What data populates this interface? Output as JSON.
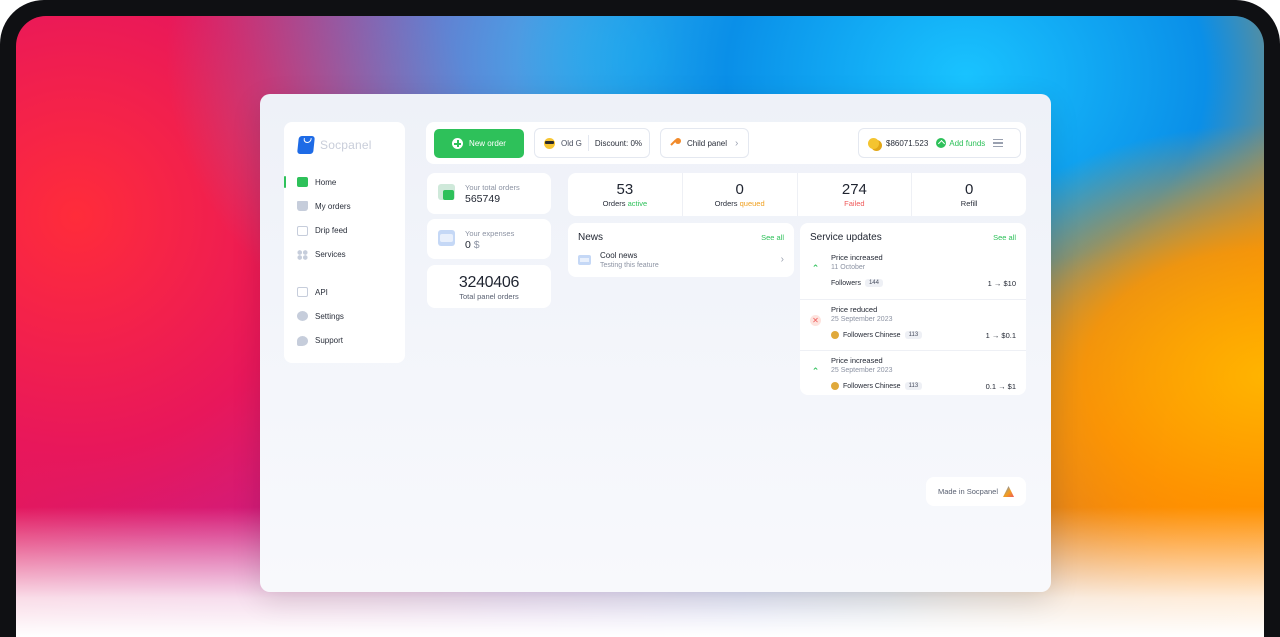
{
  "brand": {
    "name": "Socpanel"
  },
  "sidebar": {
    "items": [
      {
        "label": "Home",
        "icon": "home-icon",
        "active": true
      },
      {
        "label": "My orders",
        "icon": "cart-icon"
      },
      {
        "label": "Drip feed",
        "icon": "calendar-icon"
      },
      {
        "label": "Services",
        "icon": "grid-icon"
      },
      {
        "label": "API",
        "icon": "api-icon"
      },
      {
        "label": "Settings",
        "icon": "gear-icon"
      },
      {
        "label": "Support",
        "icon": "chat-icon"
      }
    ]
  },
  "topbar": {
    "new_order_label": "New order",
    "user_name": "Old G",
    "discount_label": "Discount: 0%",
    "child_panel_label": "Child panel",
    "balance": "$86071.523",
    "add_funds_label": "Add funds"
  },
  "stats": {
    "total_orders_label": "Your total orders",
    "total_orders_value": "565749",
    "expenses_label": "Your expenses",
    "expenses_value": "0",
    "expenses_unit": "$",
    "panel_orders_value": "3240406",
    "panel_orders_label": "Total panel orders"
  },
  "counters": [
    {
      "value": "53",
      "label": "Orders",
      "status": "active"
    },
    {
      "value": "0",
      "label": "Orders",
      "status": "queued"
    },
    {
      "value": "274",
      "label": "",
      "status": "Failed"
    },
    {
      "value": "0",
      "label": "Refill",
      "status": ""
    }
  ],
  "news": {
    "title": "News",
    "see_all_label": "See all",
    "items": [
      {
        "title": "Cool news",
        "subtitle": "Testing this feature"
      }
    ]
  },
  "service_updates": {
    "title": "Service updates",
    "see_all_label": "See all",
    "items": [
      {
        "title": "Price increased",
        "date": "11 October",
        "service": "Followers",
        "count": "144",
        "price": "1 → $10",
        "kind": "up"
      },
      {
        "title": "Price reduced",
        "date": "25 September 2023",
        "service": "Followers Chinese",
        "count": "113",
        "price": "1 → $0.1",
        "kind": "down"
      },
      {
        "title": "Price increased",
        "date": "25 September 2023",
        "service": "Followers Chinese",
        "count": "113",
        "price": "0.1 → $1",
        "kind": "up"
      }
    ]
  },
  "footer": {
    "made_in_label": "Made in Socpanel"
  },
  "colors": {
    "accent": "#2ec15a",
    "queued": "#f0a020",
    "failed": "#ef5a5a",
    "primary": "#1e6be6"
  }
}
